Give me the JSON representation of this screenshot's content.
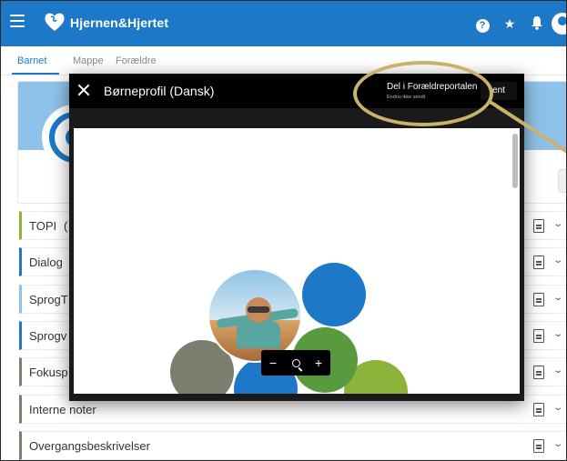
{
  "app": {
    "brand": "Hjernen&Hjertet"
  },
  "topbar_icons": {
    "help": "?",
    "star": "★",
    "bell": "🔔"
  },
  "tabs": [
    {
      "label": "Barnet",
      "active": true
    },
    {
      "label": "Mappe",
      "active": false
    },
    {
      "label": "Forældre",
      "active": false
    }
  ],
  "rows": [
    {
      "label": "TOPI",
      "suffix": "(",
      "accent": "#8cb43a"
    },
    {
      "label": "Dialog",
      "suffix": "",
      "accent": "#1e78c8"
    },
    {
      "label": "SprogT",
      "suffix": "",
      "accent": "#8fc2ea"
    },
    {
      "label": "Sprogv",
      "suffix": "",
      "accent": "#1e78c8"
    },
    {
      "label": "Fokusp",
      "suffix": "",
      "accent": "#7d7d70"
    },
    {
      "label": "Interne noter",
      "suffix": "",
      "accent": "#7d7d70"
    },
    {
      "label": "Overgangsbeskrivelser",
      "suffix": "",
      "accent": "#7d7d70"
    }
  ],
  "modal": {
    "title": "Børneprofil (Dansk)",
    "share_label": "Del i Forældreportalen",
    "share_status": "Endnu ikke sendt",
    "send_label": "ent",
    "zoom": {
      "minus": "−",
      "plus": "+"
    }
  },
  "colors": {
    "primary": "#1e78c8",
    "callout": "#c9b26b"
  }
}
